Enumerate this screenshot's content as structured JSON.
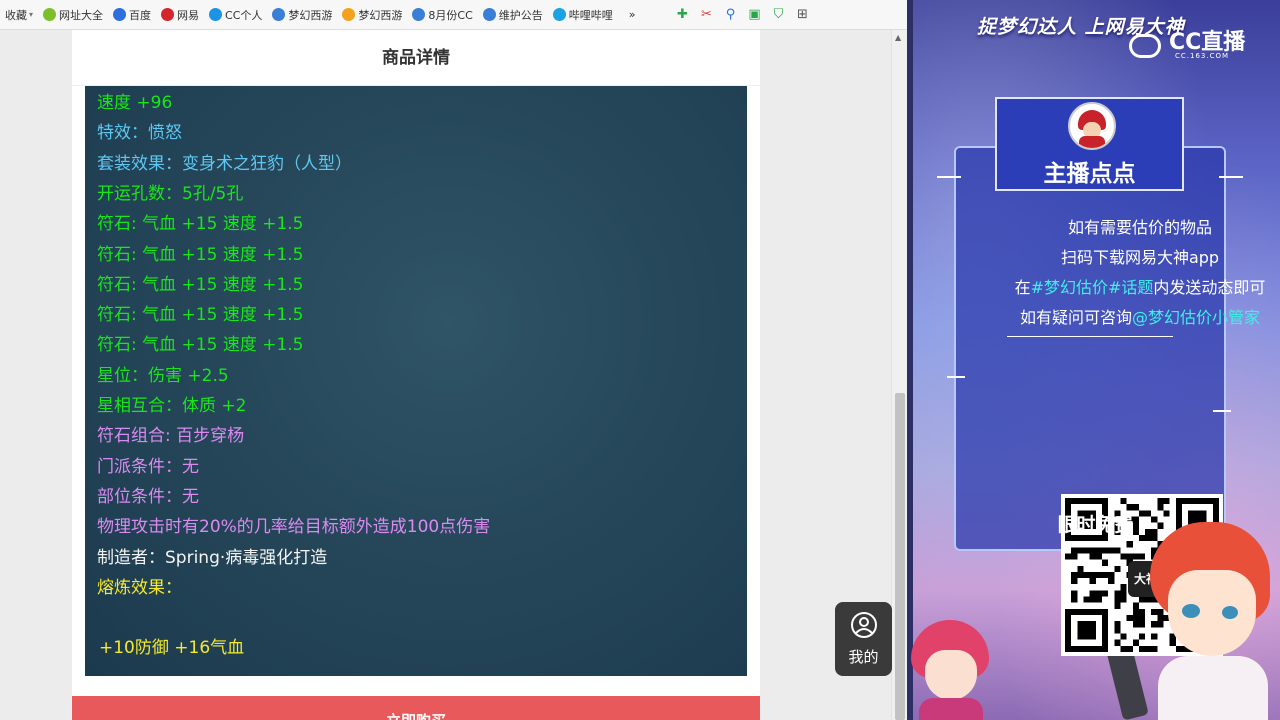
{
  "bookmarks": [
    {
      "label": "收藏",
      "icon": "folder-icon",
      "color": "#888888",
      "caret": true
    },
    {
      "label": "网址大全",
      "icon": "site-nav-icon",
      "color": "#7bbf2a"
    },
    {
      "label": "百度",
      "icon": "baidu-icon",
      "color": "#2d6fdf"
    },
    {
      "label": "网易",
      "icon": "netease-icon",
      "color": "#d6262d"
    },
    {
      "label": "CC个人",
      "icon": "cc-icon",
      "color": "#1d93e6"
    },
    {
      "label": "梦幻西游",
      "icon": "menghuan-icon",
      "color": "#3b7ed6"
    },
    {
      "label": "梦幻西游",
      "icon": "menghuan-game-icon",
      "color": "#f2a21c"
    },
    {
      "label": "8月份CC",
      "icon": "cc-month-icon",
      "color": "#3b7ed6"
    },
    {
      "label": "维护公告",
      "icon": "notice-icon",
      "color": "#3b7ed6"
    },
    {
      "label": "哔哩哔哩",
      "icon": "bilibili-icon",
      "color": "#1aa3e0"
    }
  ],
  "toolbar": {
    "more": "»",
    "icons": [
      {
        "name": "extension-icon",
        "glyph": "✚",
        "color": "#2aa64a"
      },
      {
        "name": "screenshot-icon",
        "glyph": "✂",
        "color": "#e23b3b"
      },
      {
        "name": "search-icon",
        "glyph": "⚲",
        "color": "#2a6fe0"
      },
      {
        "name": "game-icon",
        "glyph": "▣",
        "color": "#2aa64a"
      },
      {
        "name": "shield-icon",
        "glyph": "⛉",
        "color": "#2aa64a"
      },
      {
        "name": "apps-icon",
        "glyph": "⊞",
        "color": "#555555"
      }
    ]
  },
  "detail": {
    "title": "商品详情",
    "lines": [
      {
        "text": "速度 +96",
        "color": "green"
      },
      {
        "text": "特效：愤怒",
        "color": "blue"
      },
      {
        "text": "套装效果：变身术之狂豹（人型）",
        "color": "blue"
      },
      {
        "text": "开运孔数：5孔/5孔",
        "color": "green"
      },
      {
        "text": "符石: 气血 +15 速度 +1.5",
        "color": "green"
      },
      {
        "text": "符石: 气血 +15 速度 +1.5",
        "color": "green"
      },
      {
        "text": "符石: 气血 +15 速度 +1.5",
        "color": "green"
      },
      {
        "text": "符石: 气血 +15 速度 +1.5",
        "color": "green"
      },
      {
        "text": "符石: 气血 +15 速度 +1.5",
        "color": "green"
      },
      {
        "text": "星位：伤害 +2.5",
        "color": "green"
      },
      {
        "text": "星相互合：体质 +2",
        "color": "green"
      },
      {
        "text": "符石组合: 百步穿杨",
        "color": "purple"
      },
      {
        "text": "门派条件：无",
        "color": "purple"
      },
      {
        "text": "部位条件：无",
        "color": "purple"
      },
      {
        "text": "物理攻击时有20%的几率给目标额外造成100点伤害",
        "color": "purple"
      },
      {
        "text": "制造者：Spring·病毒强化打造",
        "color": "white"
      },
      {
        "text": "熔炼效果：",
        "color": "yellow"
      },
      {
        "text": "",
        "color": "yellow"
      },
      {
        "text": "+10防御 +16气血",
        "color": "yellow"
      }
    ],
    "buy_label": "立即购买"
  },
  "mine_label": "我的",
  "overlay": {
    "slogan": "捉梦幻达人 上网易大神",
    "cc_brand": "CC直播",
    "cc_url": "CC.163.COM",
    "anchor_name": "主播点点",
    "lines": [
      {
        "pre": "如有需要估价的物品",
        "hl": "",
        "post": ""
      },
      {
        "pre": "扫码下载网易大神app",
        "hl": "",
        "post": ""
      },
      {
        "pre": "在",
        "hl": "#梦幻估价#话题",
        "post": "内发送动态即可"
      },
      {
        "pre": "如有疑问可咨询",
        "hl": "@梦幻估价小管家",
        "post": ""
      }
    ],
    "qr_logo": "大神",
    "free_label": "限时免费"
  }
}
